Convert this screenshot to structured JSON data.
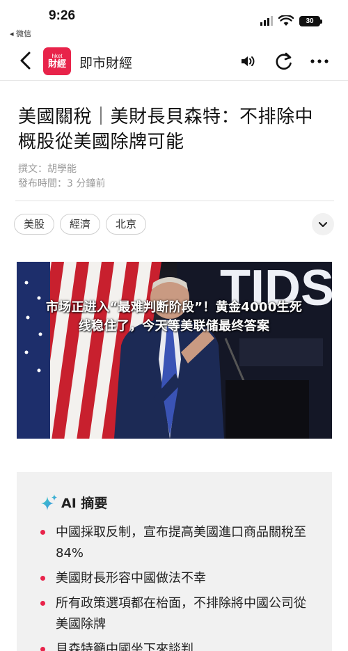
{
  "status_bar": {
    "time": "9:26",
    "back_app": "◂ 微信",
    "battery": "30"
  },
  "nav": {
    "logo_line1": "hket",
    "logo_line2": "財經",
    "title": "即市財經"
  },
  "article": {
    "headline": "美國關稅｜美財長貝森特：不排除中概股從美國除牌可能",
    "author": "撰文：胡學能",
    "published": "發布時間：3 分鐘前",
    "tags": [
      "美股",
      "經濟",
      "北京"
    ]
  },
  "hero": {
    "backdrop_text": "TIDS",
    "overlay_caption": "市场正进入“最难判断阶段”！黄金4000生死线稳住了，今天等美联储最终答案"
  },
  "ai_summary": {
    "title": "AI 摘要",
    "bullets": [
      "中國採取反制，宣布提高美國進口商品關稅至84%",
      "美國財長形容中國做法不幸",
      "所有政策選項都在枱面，不排除將中國公司從美國除牌",
      "貝森特籲中國坐下來談判"
    ]
  },
  "colors": {
    "brand": "#e8234a",
    "bullet": "#e8234a"
  },
  "icons": {
    "back": "chevron-left-icon",
    "audio": "speaker-icon",
    "refresh": "refresh-icon",
    "more": "more-icon",
    "expand": "chevron-down-icon",
    "ai": "sparkle-icon"
  }
}
